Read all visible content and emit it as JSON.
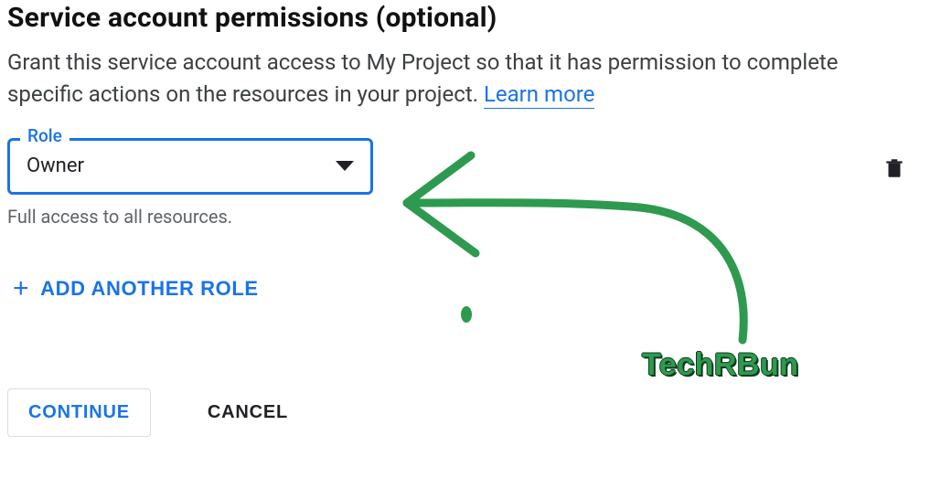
{
  "header": {
    "title": "Service account permissions (optional)"
  },
  "description": {
    "text_before_link": "Grant this service account access to My Project so that it has permission to complete specific actions on the resources in your project. ",
    "learn_more": "Learn more"
  },
  "role": {
    "label": "Role",
    "value": "Owner",
    "helper": "Full access to all resources."
  },
  "add_role_button": "ADD ANOTHER ROLE",
  "actions": {
    "continue": "CONTINUE",
    "cancel": "CANCEL"
  },
  "annotation": {
    "watermark": "TechRBun"
  }
}
